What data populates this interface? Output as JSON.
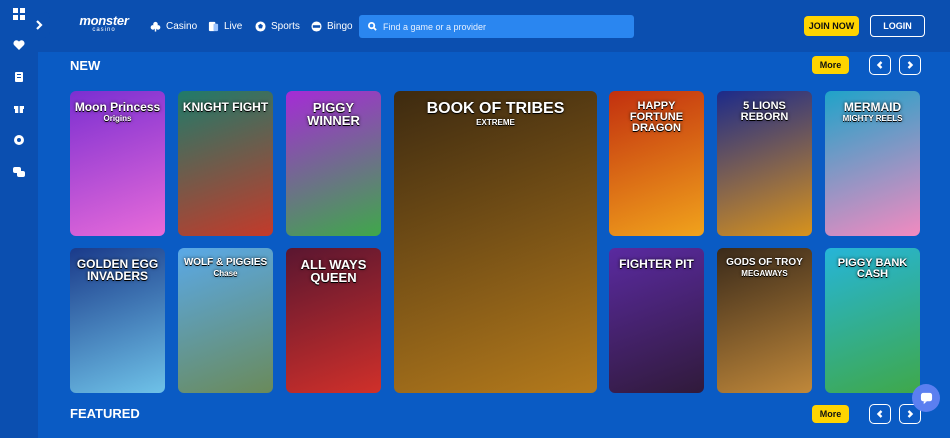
{
  "brand": {
    "name": "monster",
    "tagline": "casino"
  },
  "nav": [
    {
      "id": "casino",
      "label": "Casino"
    },
    {
      "id": "live",
      "label": "Live"
    },
    {
      "id": "sports",
      "label": "Sports"
    },
    {
      "id": "bingo",
      "label": "Bingo"
    }
  ],
  "search": {
    "placeholder": "Find a game or a provider"
  },
  "auth": {
    "join_label": "JOIN NOW",
    "login_label": "LOGIN"
  },
  "sections": {
    "new": {
      "title": "NEW",
      "more_label": "More"
    },
    "featured": {
      "title": "FEATURED",
      "more_label": "More"
    }
  },
  "games": [
    {
      "id": "moon-princess",
      "title": "Moon Princess",
      "subtitle": "Origins",
      "colors": [
        "#7b2fd1",
        "#e86bd9"
      ]
    },
    {
      "id": "knight-fight",
      "title": "KNIGHT FIGHT",
      "subtitle": "",
      "colors": [
        "#1f7b6a",
        "#c43a2a"
      ]
    },
    {
      "id": "piggy-winner",
      "title": "PIGGY WINNER",
      "subtitle": "",
      "colors": [
        "#a52bd6",
        "#3fa84a"
      ]
    },
    {
      "id": "book-of-tribes",
      "title": "BOOK OF TRIBES",
      "subtitle": "EXTREME",
      "colors": [
        "#3d2a10",
        "#b47a1c"
      ]
    },
    {
      "id": "happy-fortune-dragon",
      "title": "HAPPY FORTUNE DRAGON",
      "subtitle": "",
      "colors": [
        "#c2300f",
        "#f1a31c"
      ]
    },
    {
      "id": "5-lions-reborn",
      "title": "5 LIONS REBORN",
      "subtitle": "",
      "colors": [
        "#1c2a8a",
        "#d8931c"
      ]
    },
    {
      "id": "mermaid-mighty-reels",
      "title": "MERMAID",
      "subtitle": "MIGHTY REELS",
      "colors": [
        "#1fa3c9",
        "#f28ac0"
      ]
    },
    {
      "id": "golden-egg-invaders",
      "title": "GOLDEN EGG INVADERS",
      "subtitle": "",
      "colors": [
        "#1a3a8a",
        "#6fc2e8"
      ]
    },
    {
      "id": "wolf-vs-piggies-chase",
      "title": "WOLF & PIGGIES",
      "subtitle": "Chase",
      "colors": [
        "#5aa9e8",
        "#6a8a5a"
      ]
    },
    {
      "id": "all-ways-queen",
      "title": "ALL WAYS QUEEN",
      "subtitle": "",
      "colors": [
        "#5a1630",
        "#d0302a"
      ]
    },
    {
      "id": "fighter-pit",
      "title": "FIGHTER PIT",
      "subtitle": "",
      "colors": [
        "#5a2aa0",
        "#301a3a"
      ]
    },
    {
      "id": "gods-of-troy",
      "title": "GODS OF TROY",
      "subtitle": "MEGAWAYS",
      "colors": [
        "#3a2a1a",
        "#c0883a"
      ]
    },
    {
      "id": "piggy-bank-cash",
      "title": "PIGGY BANK CASH",
      "subtitle": "",
      "colors": [
        "#26b5d8",
        "#3fa84a"
      ]
    }
  ]
}
